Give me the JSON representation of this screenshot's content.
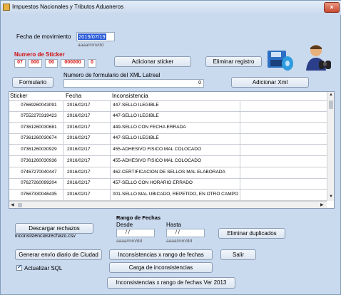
{
  "window": {
    "title": "Impuestos Nacionales y Tributos Aduaneros",
    "close_label": "×"
  },
  "movement": {
    "date_label": "Fecha de movimiento",
    "date_value": "2019/07/19",
    "date_format": "aaaa/mm/dd"
  },
  "sticker": {
    "label": "Numero de Sticker",
    "parts": [
      "07",
      "000",
      "00",
      "000000",
      "0"
    ]
  },
  "buttons": {
    "add_sticker": "Adicionar sticker",
    "delete_record": "Eliminar registro",
    "form": "Formulario",
    "add_xml": "Adicionar Xml",
    "download_rejects": "Descargar rechazos",
    "remove_duplicates": "Eliminar duplicados",
    "generate_daily": "Generar envío diario de Ciudad",
    "inconsistencies_range": "Inconsistencias x rango de fechas",
    "exit": "Salir",
    "load_inconsistencies": "Carga de inconsistencias",
    "inconsistencies_range_2013": "Inconsistencias x rango de fechas Ver 2013"
  },
  "xml": {
    "label": "Numero de formulario del XML Latreal",
    "value": "0"
  },
  "grid": {
    "columns": [
      "Sticker",
      "Fecha",
      "Inconsistencia"
    ],
    "rows": [
      [
        "07669260043091",
        "2016/02/17",
        "447-SELLO ILEGIBLE"
      ],
      [
        "07552270319423",
        "2016/02/17",
        "447-SELLO ILEGIBLE"
      ],
      [
        "07361260030681",
        "2016/02/17",
        "449-SELLO CON FECHA ERRADA"
      ],
      [
        "07361260030674",
        "2016/02/17",
        "447-SELLO ILEGIBLE"
      ],
      [
        "07361260030929",
        "2016/02/17",
        "455-ADHESIVO FISICO MAL COLOCADO"
      ],
      [
        "07361260030936",
        "2016/02/17",
        "455-ADHESIVO FISICO MAL COLOCADO"
      ],
      [
        "07467270040447",
        "2016/02/17",
        "462-CERTIFICACION DE SELLOS MAL ELABORADA"
      ],
      [
        "07627260099204",
        "2016/02/17",
        "457-SELLO CON HORARIO ERRADO"
      ],
      [
        "07667330046435",
        "2016/02/17",
        "001-SELLO MAL UBICADO, REPETIDO, EN OTRO CAMPO"
      ]
    ]
  },
  "rejects_file": "inconsistenciasrechazo.csv",
  "date_range": {
    "title": "Rango de Fechas",
    "from_label": "Desde",
    "to_label": "Hasta",
    "from_value": "/ /",
    "to_value": "/ /",
    "format": "aaaa/mm/dd"
  },
  "sql": {
    "label": "Actualizar SQL",
    "checked": true,
    "check_mark": "✓"
  },
  "icons": [
    "disk-icon",
    "user-binoculars-icon"
  ]
}
